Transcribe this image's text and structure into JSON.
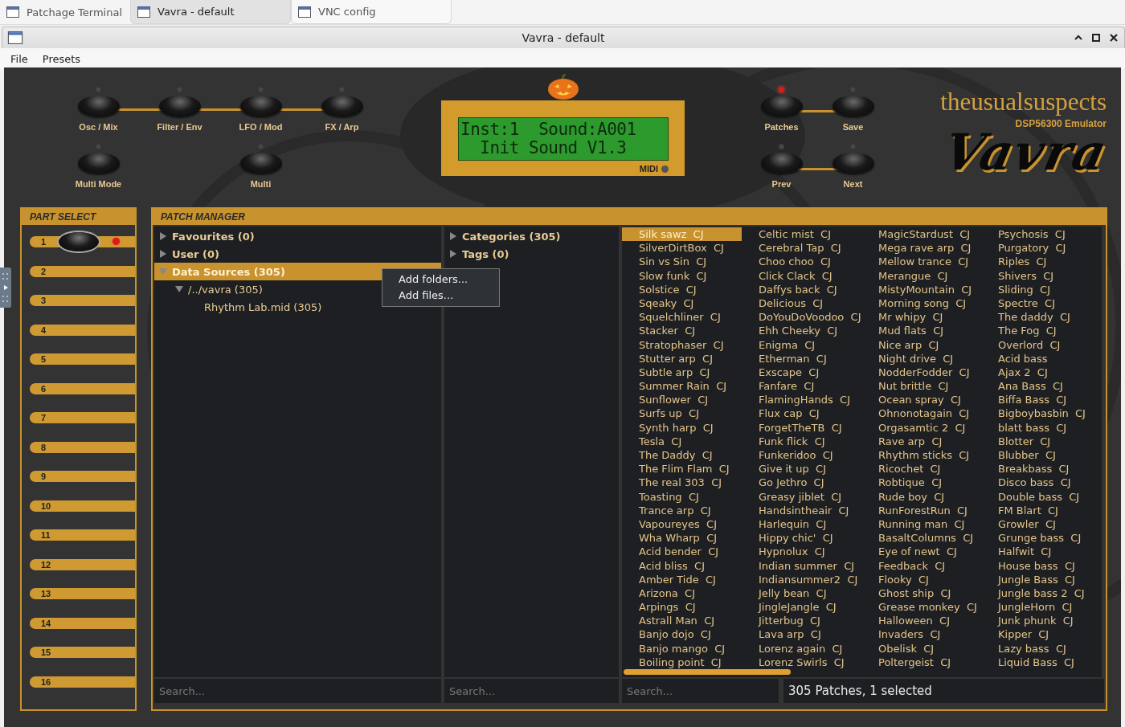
{
  "taskbar": {
    "tabs": [
      {
        "label": "Patchage Terminal",
        "selected": false
      },
      {
        "label": "Vavra - default",
        "selected": true
      },
      {
        "label": "VNC config",
        "selected": false
      }
    ]
  },
  "window": {
    "title": "Vavra - default"
  },
  "menu": [
    "File",
    "Presets"
  ],
  "synth": {
    "upper_buttons": [
      {
        "label": "Osc / Mix",
        "led_on": false
      },
      {
        "label": "Filter / Env",
        "led_on": false
      },
      {
        "label": "LFO / Mod",
        "led_on": false
      },
      {
        "label": "FX / Arp",
        "led_on": false
      }
    ],
    "lower_buttons": [
      {
        "label": "Multi Mode",
        "led_on": false
      },
      {
        "label": "Multi",
        "led_on": false
      }
    ],
    "lcd": {
      "lines": [
        "Inst:1  Sound:A001",
        "  Init Sound V1.3"
      ],
      "midi_label": "MIDI",
      "midi_on": false
    },
    "nav_buttons": [
      {
        "label": "Patches",
        "led_on": true
      },
      {
        "label": "Save",
        "led_on": false
      },
      {
        "label": "Prev",
        "led_on": false
      },
      {
        "label": "Next",
        "led_on": false
      }
    ],
    "brand": {
      "maker": "theusualsuspects",
      "subtitle": "DSP56300 Emulator",
      "logo": "Vavra"
    }
  },
  "part_select": {
    "title": "PART SELECT",
    "parts": [
      {
        "number": "1",
        "selected": true
      },
      {
        "number": "2",
        "selected": false
      },
      {
        "number": "3",
        "selected": false
      },
      {
        "number": "4",
        "selected": false
      },
      {
        "number": "5",
        "selected": false
      },
      {
        "number": "6",
        "selected": false
      },
      {
        "number": "7",
        "selected": false
      },
      {
        "number": "8",
        "selected": false
      },
      {
        "number": "9",
        "selected": false
      },
      {
        "number": "10",
        "selected": false
      },
      {
        "number": "11",
        "selected": false
      },
      {
        "number": "12",
        "selected": false
      },
      {
        "number": "13",
        "selected": false
      },
      {
        "number": "14",
        "selected": false
      },
      {
        "number": "15",
        "selected": false
      },
      {
        "number": "16",
        "selected": false
      }
    ]
  },
  "patch_manager": {
    "title": "PATCH MANAGER",
    "tree": [
      {
        "label": "Favourites (0)",
        "expanded": false,
        "selected": false
      },
      {
        "label": "User (0)",
        "expanded": false,
        "selected": false
      },
      {
        "label": "Data Sources (305)",
        "expanded": true,
        "selected": true,
        "children": [
          {
            "label": "/../vavra (305)",
            "expanded": true,
            "selected": false,
            "children": [
              {
                "label": "Rhythm Lab.mid (305)",
                "selected": false
              }
            ]
          }
        ]
      }
    ],
    "categories": [
      {
        "label": "Categories (305)",
        "expanded": false,
        "selected": false
      },
      {
        "label": "Tags (0)",
        "expanded": false,
        "selected": false
      }
    ],
    "context_menu": [
      "Add folders...",
      "Add files..."
    ],
    "patches": [
      {
        "name": "Silk sawz",
        "author": "CJ",
        "selected": true
      },
      {
        "name": "SilverDirtBox",
        "author": "CJ",
        "selected": false
      },
      {
        "name": "Sin vs Sin",
        "author": "CJ",
        "selected": false
      },
      {
        "name": "Slow funk",
        "author": "CJ",
        "selected": false
      },
      {
        "name": "Solstice",
        "author": "CJ",
        "selected": false
      },
      {
        "name": "Sqeaky",
        "author": "CJ",
        "selected": false
      },
      {
        "name": "Squelchliner",
        "author": "CJ",
        "selected": false
      },
      {
        "name": "Stacker",
        "author": "CJ",
        "selected": false
      },
      {
        "name": "Stratophaser",
        "author": "CJ",
        "selected": false
      },
      {
        "name": "Stutter arp",
        "author": "CJ",
        "selected": false
      },
      {
        "name": "Subtle arp",
        "author": "CJ",
        "selected": false
      },
      {
        "name": "Summer Rain",
        "author": "CJ",
        "selected": false
      },
      {
        "name": "Sunflower",
        "author": "CJ",
        "selected": false
      },
      {
        "name": "Surfs up",
        "author": "CJ",
        "selected": false
      },
      {
        "name": "Synth harp",
        "author": "CJ",
        "selected": false
      },
      {
        "name": "Tesla",
        "author": "CJ",
        "selected": false
      },
      {
        "name": "The Daddy",
        "author": "CJ",
        "selected": false
      },
      {
        "name": "The Flim Flam",
        "author": "CJ",
        "selected": false
      },
      {
        "name": "The real 303",
        "author": "CJ",
        "selected": false
      },
      {
        "name": "Toasting",
        "author": "CJ",
        "selected": false
      },
      {
        "name": "Trance arp",
        "author": "CJ",
        "selected": false
      },
      {
        "name": "Vapoureyes",
        "author": "CJ",
        "selected": false
      },
      {
        "name": "Wha Wharp",
        "author": "CJ",
        "selected": false
      },
      {
        "name": "Acid bender",
        "author": "CJ",
        "selected": false
      },
      {
        "name": "Acid bliss",
        "author": "CJ",
        "selected": false
      },
      {
        "name": "Amber Tide",
        "author": "CJ",
        "selected": false
      },
      {
        "name": "Arizona",
        "author": "CJ",
        "selected": false
      },
      {
        "name": "Arpings",
        "author": "CJ",
        "selected": false
      },
      {
        "name": "Astrall Man",
        "author": "CJ",
        "selected": false
      },
      {
        "name": "Banjo dojo",
        "author": "CJ",
        "selected": false
      },
      {
        "name": "Banjo mango",
        "author": "CJ",
        "selected": false
      },
      {
        "name": "Boiling point",
        "author": "CJ",
        "selected": false
      },
      {
        "name": "Celtic mist",
        "author": "CJ",
        "selected": false
      },
      {
        "name": "Cerebral Tap",
        "author": "CJ",
        "selected": false
      },
      {
        "name": "Choo choo",
        "author": "CJ",
        "selected": false
      },
      {
        "name": "Click Clack",
        "author": "CJ",
        "selected": false
      },
      {
        "name": "Daffys back",
        "author": "CJ",
        "selected": false
      },
      {
        "name": "Delicious",
        "author": "CJ",
        "selected": false
      },
      {
        "name": "DoYouDoVoodoo",
        "author": "CJ",
        "selected": false
      },
      {
        "name": "Ehh Cheeky",
        "author": "CJ",
        "selected": false
      },
      {
        "name": "Enigma",
        "author": "CJ",
        "selected": false
      },
      {
        "name": "Etherman",
        "author": "CJ",
        "selected": false
      },
      {
        "name": "Exscape",
        "author": "CJ",
        "selected": false
      },
      {
        "name": "Fanfare",
        "author": "CJ",
        "selected": false
      },
      {
        "name": "FlamingHands",
        "author": "CJ",
        "selected": false
      },
      {
        "name": "Flux cap",
        "author": "CJ",
        "selected": false
      },
      {
        "name": "ForgetTheTB",
        "author": "CJ",
        "selected": false
      },
      {
        "name": "Funk flick",
        "author": "CJ",
        "selected": false
      },
      {
        "name": "Funkeridoo",
        "author": "CJ",
        "selected": false
      },
      {
        "name": "Give it up",
        "author": "CJ",
        "selected": false
      },
      {
        "name": "Go Jethro",
        "author": "CJ",
        "selected": false
      },
      {
        "name": "Greasy jiblet",
        "author": "CJ",
        "selected": false
      },
      {
        "name": "Handsintheair",
        "author": "CJ",
        "selected": false
      },
      {
        "name": "Harlequin",
        "author": "CJ",
        "selected": false
      },
      {
        "name": "Hippy chic'",
        "author": "CJ",
        "selected": false
      },
      {
        "name": "Hypnolux",
        "author": "CJ",
        "selected": false
      },
      {
        "name": "Indian summer",
        "author": "CJ",
        "selected": false
      },
      {
        "name": "Indiansummer2",
        "author": "CJ",
        "selected": false
      },
      {
        "name": "Jelly bean",
        "author": "CJ",
        "selected": false
      },
      {
        "name": "JingleJangle",
        "author": "CJ",
        "selected": false
      },
      {
        "name": "Jitterbug",
        "author": "CJ",
        "selected": false
      },
      {
        "name": "Lava arp",
        "author": "CJ",
        "selected": false
      },
      {
        "name": "Lorenz again",
        "author": "CJ",
        "selected": false
      },
      {
        "name": "Lorenz Swirls",
        "author": "CJ",
        "selected": false
      },
      {
        "name": "MagicStardust",
        "author": "CJ",
        "selected": false
      },
      {
        "name": "Mega rave arp",
        "author": "CJ",
        "selected": false
      },
      {
        "name": "Mellow trance",
        "author": "CJ",
        "selected": false
      },
      {
        "name": "Merangue",
        "author": "CJ",
        "selected": false
      },
      {
        "name": "MistyMountain",
        "author": "CJ",
        "selected": false
      },
      {
        "name": "Morning song",
        "author": "CJ",
        "selected": false
      },
      {
        "name": "Mr whipy",
        "author": "CJ",
        "selected": false
      },
      {
        "name": "Mud flats",
        "author": "CJ",
        "selected": false
      },
      {
        "name": "Nice arp",
        "author": "CJ",
        "selected": false
      },
      {
        "name": "Night drive",
        "author": "CJ",
        "selected": false
      },
      {
        "name": "NodderFodder",
        "author": "CJ",
        "selected": false
      },
      {
        "name": "Nut brittle",
        "author": "CJ",
        "selected": false
      },
      {
        "name": "Ocean spray",
        "author": "CJ",
        "selected": false
      },
      {
        "name": "Ohnonotagain",
        "author": "CJ",
        "selected": false
      },
      {
        "name": "Orgasamtic 2",
        "author": "CJ",
        "selected": false
      },
      {
        "name": "Rave arp",
        "author": "CJ",
        "selected": false
      },
      {
        "name": "Rhythm sticks",
        "author": "CJ",
        "selected": false
      },
      {
        "name": "Ricochet",
        "author": "CJ",
        "selected": false
      },
      {
        "name": "Robtique",
        "author": "CJ",
        "selected": false
      },
      {
        "name": "Rude boy",
        "author": "CJ",
        "selected": false
      },
      {
        "name": "RunForestRun",
        "author": "CJ",
        "selected": false
      },
      {
        "name": "Running man",
        "author": "CJ",
        "selected": false
      },
      {
        "name": "BasaltColumns",
        "author": "CJ",
        "selected": false
      },
      {
        "name": "Eye of newt",
        "author": "CJ",
        "selected": false
      },
      {
        "name": "Feedback",
        "author": "CJ",
        "selected": false
      },
      {
        "name": "Flooky",
        "author": "CJ",
        "selected": false
      },
      {
        "name": "Ghost ship",
        "author": "CJ",
        "selected": false
      },
      {
        "name": "Grease monkey",
        "author": "CJ",
        "selected": false
      },
      {
        "name": "Halloween",
        "author": "CJ",
        "selected": false
      },
      {
        "name": "Invaders",
        "author": "CJ",
        "selected": false
      },
      {
        "name": "Obelisk",
        "author": "CJ",
        "selected": false
      },
      {
        "name": "Poltergeist",
        "author": "CJ",
        "selected": false
      },
      {
        "name": "Psychosis",
        "author": "CJ",
        "selected": false
      },
      {
        "name": "Purgatory",
        "author": "CJ",
        "selected": false
      },
      {
        "name": "Riples",
        "author": "CJ",
        "selected": false
      },
      {
        "name": "Shivers",
        "author": "CJ",
        "selected": false
      },
      {
        "name": "Sliding",
        "author": "CJ",
        "selected": false
      },
      {
        "name": "Spectre",
        "author": "CJ",
        "selected": false
      },
      {
        "name": "The daddy",
        "author": "CJ",
        "selected": false
      },
      {
        "name": "The Fog",
        "author": "CJ",
        "selected": false
      },
      {
        "name": "Overlord",
        "author": "CJ",
        "selected": false
      },
      {
        "name": "Acid bass",
        "selected": false
      },
      {
        "name": "Ajax 2",
        "author": "CJ",
        "selected": false
      },
      {
        "name": "Ana Bass",
        "author": "CJ",
        "selected": false
      },
      {
        "name": "Biffa Bass",
        "author": "CJ",
        "selected": false
      },
      {
        "name": "Bigboybasbin",
        "author": "CJ",
        "selected": false
      },
      {
        "name": "blatt bass",
        "author": "CJ",
        "selected": false
      },
      {
        "name": "Blotter",
        "author": "CJ",
        "selected": false
      },
      {
        "name": "Blubber",
        "author": "CJ",
        "selected": false
      },
      {
        "name": "Breakbass",
        "author": "CJ",
        "selected": false
      },
      {
        "name": "Disco bass",
        "author": "CJ",
        "selected": false
      },
      {
        "name": "Double bass",
        "author": "CJ",
        "selected": false
      },
      {
        "name": "FM Blart",
        "author": "CJ",
        "selected": false
      },
      {
        "name": "Growler",
        "author": "CJ",
        "selected": false
      },
      {
        "name": "Grunge bass",
        "author": "CJ",
        "selected": false
      },
      {
        "name": "Halfwit",
        "author": "CJ",
        "selected": false
      },
      {
        "name": "House bass",
        "author": "CJ",
        "selected": false
      },
      {
        "name": "Jungle Bass",
        "author": "CJ",
        "selected": false
      },
      {
        "name": "Jungle bass 2",
        "author": "CJ",
        "selected": false
      },
      {
        "name": "JungleHorn",
        "author": "CJ",
        "selected": false
      },
      {
        "name": "Junk phunk",
        "author": "CJ",
        "selected": false
      },
      {
        "name": "Kipper",
        "author": "CJ",
        "selected": false
      },
      {
        "name": "Lazy bass",
        "author": "CJ",
        "selected": false
      },
      {
        "name": "Liquid Bass",
        "author": "CJ",
        "selected": false
      }
    ],
    "search_placeholders": [
      "Search...",
      "Search...",
      "Search..."
    ],
    "status": "305 Patches, 1 selected"
  }
}
